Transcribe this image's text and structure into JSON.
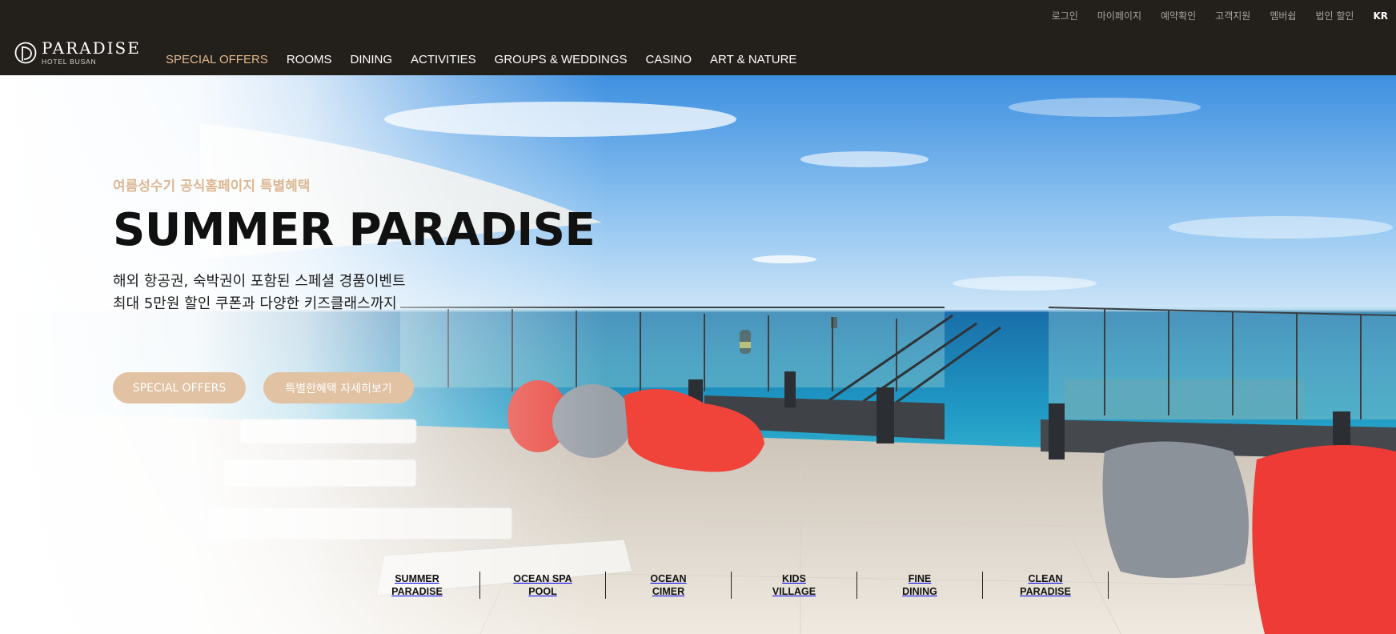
{
  "utility_nav": [
    "로그인",
    "마이페이지",
    "예약확인",
    "고객지원",
    "멤버쉽",
    "법인 할인"
  ],
  "language": "KR",
  "logo": {
    "name": "PARADISE",
    "sub": "HOTEL BUSAN"
  },
  "main_nav": {
    "items": [
      "SPECIAL OFFERS",
      "ROOMS",
      "DINING",
      "ACTIVITIES",
      "GROUPS & WEDDINGS",
      "CASINO",
      "ART & NATURE"
    ],
    "active_index": 0
  },
  "hero": {
    "eyebrow": "여름성수기 공식홈페이지 특별혜택",
    "title": "SUMMER PARADISE",
    "desc_line1": "해외 항공권, 숙박권이 포함된 스페셜 경품이벤트",
    "desc_line2": "최대 5만원 할인 쿠폰과 다양한 키즈클래스까지",
    "cta_primary": "SPECIAL OFFERS",
    "cta_secondary": "특별한혜택 자세히보기"
  },
  "quick_links": [
    "SUMMER\nPARADISE",
    "OCEAN SPA\nPOOL",
    "OCEAN\nCIMER",
    "KIDS\nVILLAGE",
    "FINE\nDINING",
    "CLEAN\nPARADISE"
  ],
  "colors": {
    "header_bg": "#231f1b",
    "accent": "#e2b98e",
    "button_bg": "#e1c2a3"
  }
}
